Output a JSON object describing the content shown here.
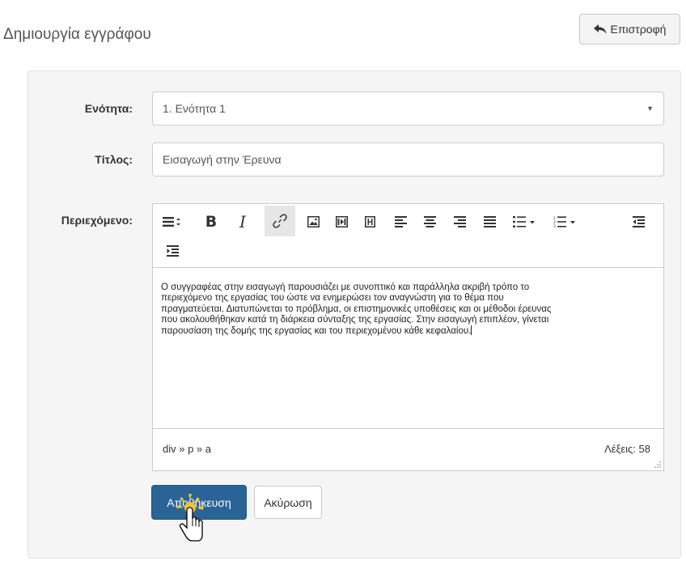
{
  "header": {
    "title": "Δημιουργία εγγράφου",
    "back_label": "Επιστροφή"
  },
  "form": {
    "section_label": "Ενότητα:",
    "section_value": "1. Ενότητα 1",
    "title_label": "Τίτλος:",
    "title_value": "Εισαγωγή στην Έρευνα",
    "content_label": "Περιεχόμενο:"
  },
  "editor": {
    "lines": [
      "Ο συγγραφέας στην εισαγωγή παρουσιάζει με συνοπτικό και παράλληλα ακριβή τρόπο το",
      "περιεχόμενο της εργασίας του ώστε να ενημερώσει τον αναγνώστη για το θέμα που",
      "πραγματεύεται. Διατυπώνεται το πρόβλημα, οι επιστημονικές υποθέσεις και οι μέθοδοι έρευνας",
      "που ακολουθήθηκαν κατά τη διάρκεια σύνταξης της εργασίας. Στην εισαγωγή επιπλέον, γίνεται",
      "παρουσίαση της δομής της εργασίας και του περιεχομένου κάθε κεφαλαίου."
    ],
    "path": "div » p » a",
    "wordcount": "Λέξεις: 58",
    "toolbar": [
      "format-icon",
      "bold-icon",
      "italic-icon",
      "link-icon",
      "image-icon",
      "media-icon",
      "template-icon",
      "align-left-icon",
      "align-center-icon",
      "align-right-icon",
      "align-justify-icon",
      "bullet-list-icon",
      "numbered-list-icon",
      "outdent-icon",
      "indent-icon"
    ]
  },
  "actions": {
    "save_label": "Αποθήκευση",
    "cancel_label": "Ακύρωση"
  },
  "colors": {
    "primary": "#2a6496",
    "panel_bg": "#f5f5f5",
    "border": "#cccccc"
  }
}
